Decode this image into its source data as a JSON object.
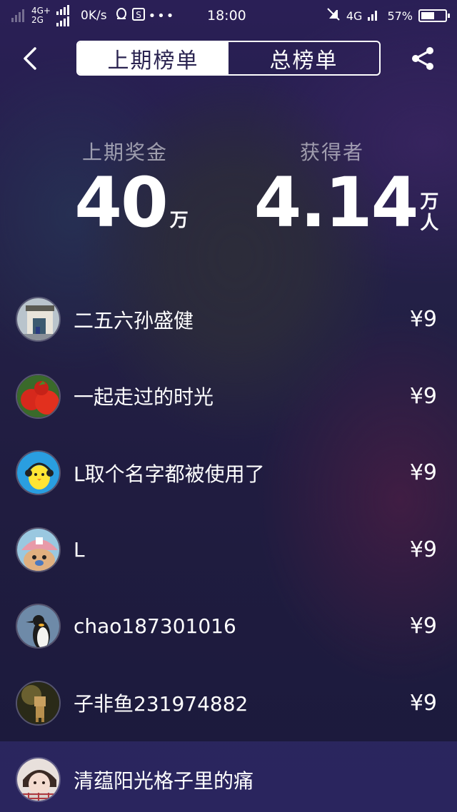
{
  "status_bar": {
    "net_top": "4G+",
    "net_bottom": "2G",
    "speed": "0K/s",
    "time": "18:00",
    "net_right": "4G",
    "battery_pct": "57%",
    "battery_level": 0.57
  },
  "header": {
    "tabs": [
      {
        "label": "上期榜单",
        "active": true
      },
      {
        "label": "总榜单",
        "active": false
      }
    ]
  },
  "stats": {
    "prize": {
      "label": "上期奖金",
      "value": "40",
      "unit": "万"
    },
    "winners": {
      "label": "获得者",
      "value": "4.14",
      "unit_top": "万",
      "unit_bottom": "人"
    }
  },
  "ranking": [
    {
      "name": "二五六孙盛健",
      "amount": "¥9",
      "avatar": "building"
    },
    {
      "name": "一起走过的时光",
      "amount": "¥9",
      "avatar": "tomatoes"
    },
    {
      "name": "L取个名字都被使用了",
      "amount": "¥9",
      "avatar": "yellow-chick"
    },
    {
      "name": "L",
      "amount": "¥9",
      "avatar": "cartoon-bear"
    },
    {
      "name": "chao187301016",
      "amount": "¥9",
      "avatar": "penguin"
    },
    {
      "name": "子非鱼231974882",
      "amount": "¥9",
      "avatar": "box-figure"
    },
    {
      "name": "清蕴阳光格子里的痛",
      "amount": "",
      "avatar": "girl-scarf"
    }
  ],
  "colors": {
    "accent_dark": "#2a2350",
    "highlight_row": "#2d2864"
  }
}
